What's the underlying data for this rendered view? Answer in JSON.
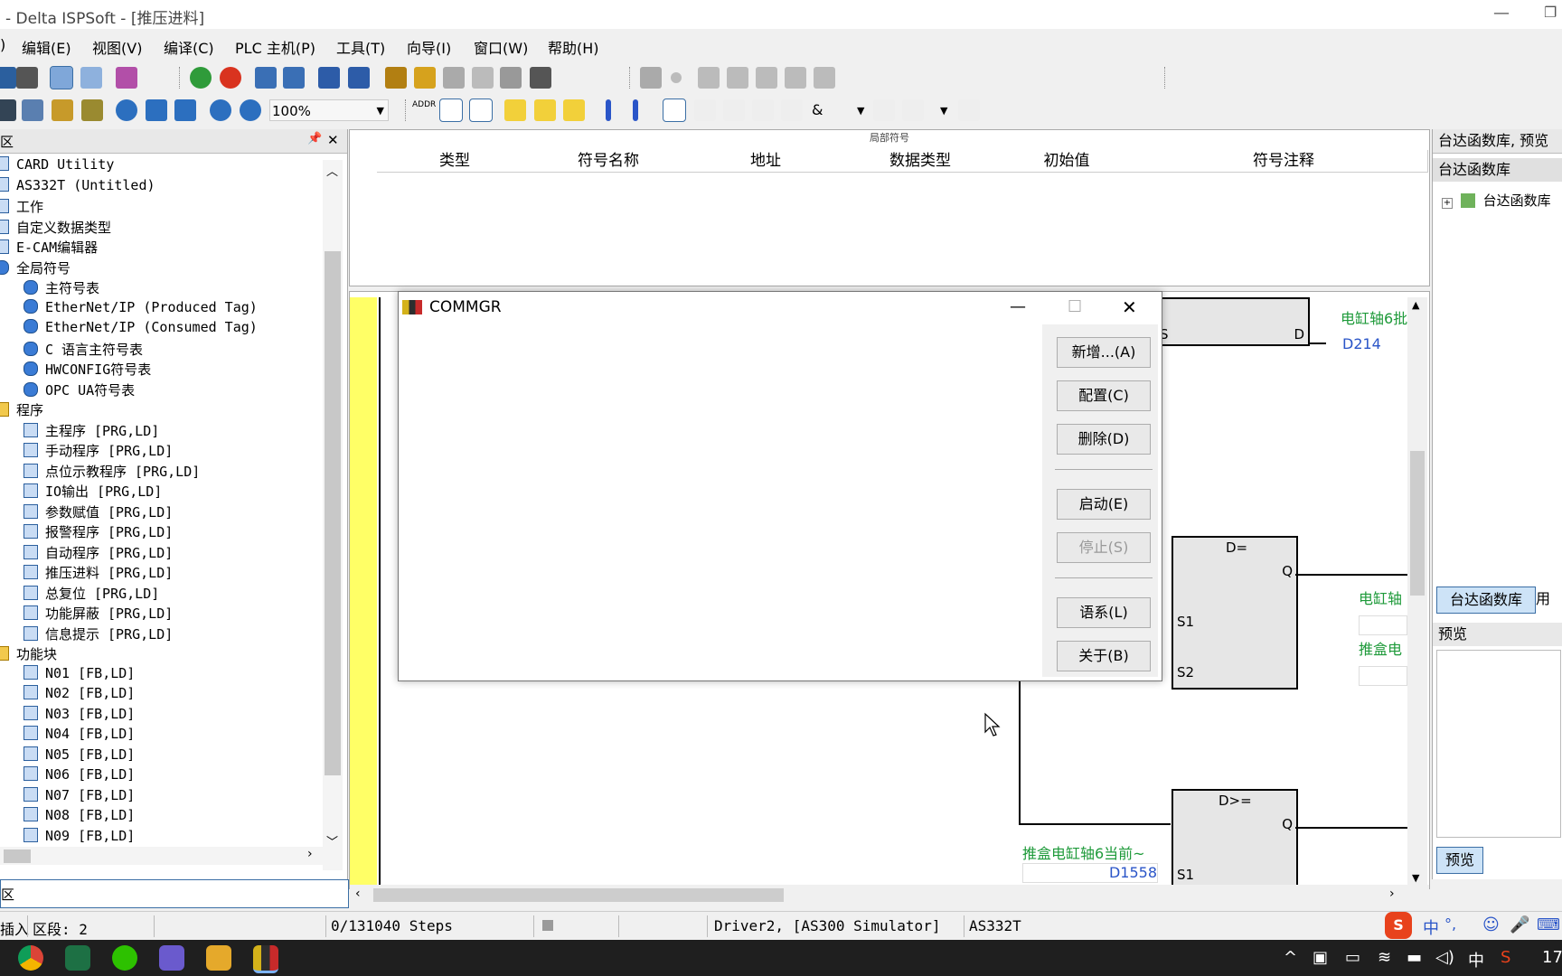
{
  "window": {
    "title": "- Delta ISPSoft - [推压进料]",
    "minimize_glyph": "—",
    "restore_glyph": "❐"
  },
  "menu": [
    {
      "label": ")"
    },
    {
      "label": "编辑(E)"
    },
    {
      "label": "视图(V)"
    },
    {
      "label": "编译(C)"
    },
    {
      "label": "PLC 主机(P)"
    },
    {
      "label": "工具(T)"
    },
    {
      "label": "向导(I)"
    },
    {
      "label": "窗口(W)"
    },
    {
      "label": "帮助(H)"
    }
  ],
  "toolbar2": {
    "zoom": "100%",
    "addr_label": "ADDR",
    "amp_label": "&"
  },
  "left_panel": {
    "header_label": "区",
    "pin_glyph": "📌",
    "close_glyph": "✕",
    "tree": [
      {
        "label": "CARD Utility"
      },
      {
        "label": "AS332T  (Untitled)"
      },
      {
        "label": "工作"
      },
      {
        "label": "自定义数据类型"
      },
      {
        "label": "E-CAM编辑器"
      },
      {
        "label": "全局符号"
      },
      {
        "label": "主符号表"
      },
      {
        "label": "EtherNet/IP (Produced Tag)"
      },
      {
        "label": "EtherNet/IP (Consumed Tag)"
      },
      {
        "label": "C 语言主符号表"
      },
      {
        "label": "HWCONFIG符号表"
      },
      {
        "label": "OPC UA符号表"
      },
      {
        "label": "程序"
      },
      {
        "label": "主程序 [PRG,LD]"
      },
      {
        "label": "手动程序 [PRG,LD]"
      },
      {
        "label": "点位示教程序 [PRG,LD]"
      },
      {
        "label": "IO输出 [PRG,LD]"
      },
      {
        "label": "参数赋值 [PRG,LD]"
      },
      {
        "label": "报警程序 [PRG,LD]"
      },
      {
        "label": "自动程序 [PRG,LD]"
      },
      {
        "label": "推压进料 [PRG,LD]"
      },
      {
        "label": "总复位 [PRG,LD]"
      },
      {
        "label": "功能屏蔽 [PRG,LD]"
      },
      {
        "label": "信息提示 [PRG,LD]"
      },
      {
        "label": "功能块"
      },
      {
        "label": "N01 [FB,LD]"
      },
      {
        "label": "N02 [FB,LD]"
      },
      {
        "label": "N03 [FB,LD]"
      },
      {
        "label": "N04 [FB,LD]"
      },
      {
        "label": "N05 [FB,LD]"
      },
      {
        "label": "N06 [FB,LD]"
      },
      {
        "label": "N07 [FB,LD]"
      },
      {
        "label": "N08 [FB,LD]"
      },
      {
        "label": "N09 [FB,LD]"
      }
    ],
    "search_label": "区"
  },
  "symbol_table": {
    "caption": "局部符号",
    "columns": [
      "类型",
      "符号名称",
      "地址",
      "数据类型",
      "初始值",
      "符号注释"
    ]
  },
  "ladder": {
    "block1": {
      "pin_s": "S",
      "pin_d": "D",
      "green_label": "电缸轴6批",
      "reg": "D214"
    },
    "block2": {
      "title": "D=",
      "pin_q": "Q",
      "pin_s1": "S1",
      "pin_s2": "S2",
      "green1": "电缸轴",
      "green2": "推盒电"
    },
    "block3": {
      "title": "D>=",
      "pin_q": "Q",
      "pin_s1": "S1",
      "green_label": "推盒电缸轴6当前~",
      "reg": "D1558"
    }
  },
  "right_panel": {
    "header": "台达函数库, 预览",
    "lib_tab": "台达函数库",
    "tree_item": "台达函数库",
    "tab1": "台达函数库",
    "tab2": "用户",
    "preview_label": "预览",
    "preview_tab": "预览"
  },
  "dialog": {
    "title": "COMMGR",
    "buttons": {
      "add": "新增...(A)",
      "config": "配置(C)",
      "delete": "删除(D)",
      "start": "启动(E)",
      "stop": "停止(S)",
      "language": "语系(L)",
      "about": "关于(B)"
    },
    "min_glyph": "—",
    "max_glyph": "☐",
    "close_glyph": "✕"
  },
  "status": {
    "mode": "插入",
    "section": "区段: 2",
    "steps": "0/131040 Steps",
    "driver": "Driver2, [AS300 Simulator]",
    "model": "AS332T"
  },
  "taskbar": {
    "ime_lang": "中",
    "clock": "17"
  },
  "colors": {
    "ladder_green": "#1e9a3a",
    "register_blue": "#2a55c8",
    "rail_yellow": "#ffff66",
    "taskbar": "#1f1f1f"
  }
}
